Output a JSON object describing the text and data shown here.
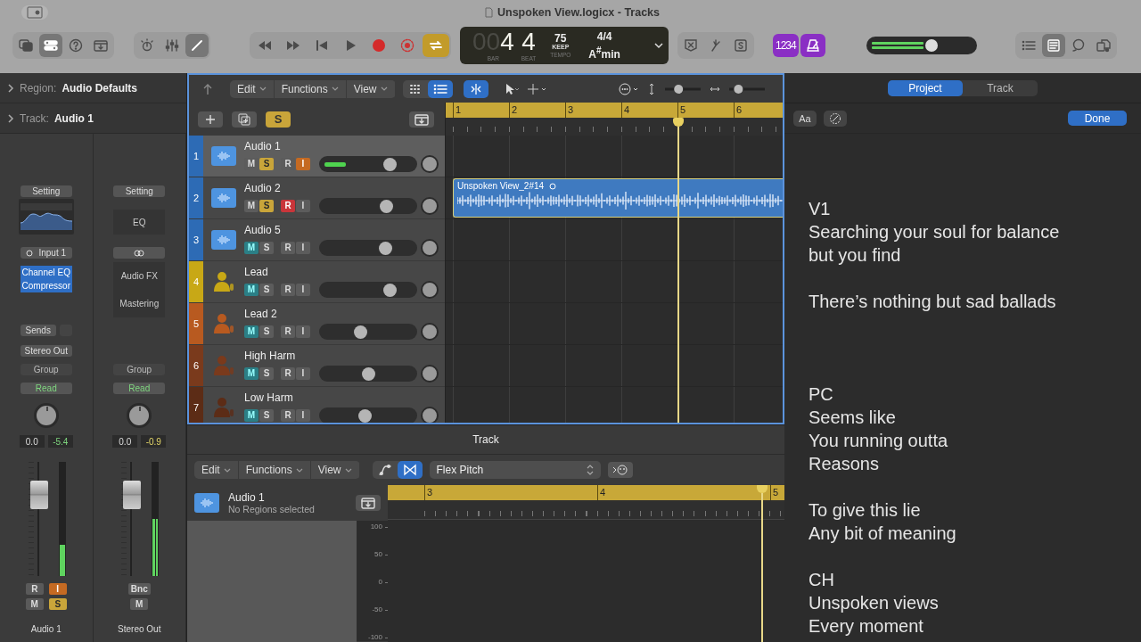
{
  "window": {
    "title": "Unspoken View.logicx - Tracks"
  },
  "toolbar": {
    "view_buttons": [
      {
        "kind": "library",
        "selected": false
      },
      {
        "kind": "inspector",
        "selected": true
      },
      {
        "kind": "help",
        "selected": false
      },
      {
        "kind": "download",
        "selected": false
      }
    ],
    "edit_buttons": [
      {
        "kind": "smart-controls",
        "selected": false
      },
      {
        "kind": "mixer",
        "selected": false
      },
      {
        "kind": "editors",
        "selected": true
      }
    ],
    "transport": [
      {
        "kind": "rewind",
        "selected": false
      },
      {
        "kind": "forward",
        "selected": false
      },
      {
        "kind": "to-start",
        "selected": false
      },
      {
        "kind": "play",
        "selected": false
      },
      {
        "kind": "record",
        "selected": false
      },
      {
        "kind": "capture",
        "selected": false
      },
      {
        "kind": "cycle",
        "selected": true
      }
    ],
    "lcd": {
      "bar_prefix": "00",
      "bar": "4",
      "beat": "4",
      "bar_label": "BAR",
      "beat_label": "BEAT",
      "tempo": "75",
      "tempo_mode": "KEEP",
      "tempo_label": "TEMPO",
      "signature": "4/4",
      "key": "A$^{#}$min"
    },
    "mode_buttons": [
      {
        "kind": "x-box",
        "selected": false
      },
      {
        "kind": "tuner",
        "selected": false
      },
      {
        "kind": "s-box",
        "selected": false
      }
    ],
    "count_in": {
      "label": "1234",
      "selected": true
    },
    "metronome": {
      "selected": true
    },
    "master_volume": {
      "level": 0.6
    },
    "window_buttons": [
      {
        "kind": "list",
        "selected": false
      },
      {
        "kind": "notes",
        "selected": true
      },
      {
        "kind": "loops",
        "selected": false
      },
      {
        "kind": "browser",
        "selected": false
      }
    ]
  },
  "inspector": {
    "region": {
      "label": "Region:",
      "value": "Audio Defaults"
    },
    "track": {
      "label": "Track:",
      "value": "Audio 1"
    },
    "strips": [
      {
        "setting": "Setting",
        "eq": {
          "kind": "graph"
        },
        "input": {
          "kind": "input",
          "text": "Input 1"
        },
        "plugins": [
          "Channel EQ",
          "Compressor"
        ],
        "sends": "Sends",
        "output": "Stereo Out",
        "group": "Group",
        "automation": "Read",
        "volume": "0.0",
        "peak": "-5.4",
        "peak_warning": false,
        "fader": {
          "level": 0.78
        },
        "meter": {
          "level": 0.27
        },
        "buttons_top": [
          {
            "label": "R",
            "kind": "record",
            "on": false
          },
          {
            "label": "I",
            "kind": "input",
            "on": true
          }
        ],
        "buttons_bottom": [
          {
            "label": "M",
            "kind": "mute",
            "on": false
          },
          {
            "label": "S",
            "kind": "solo",
            "on": true
          }
        ],
        "name": "Audio 1"
      },
      {
        "setting": "Setting",
        "eq": {
          "kind": "label",
          "text": "EQ"
        },
        "input": {
          "kind": "link"
        },
        "fx_labels": [
          "Audio FX",
          "Mastering"
        ],
        "group": "Group",
        "automation": "Read",
        "volume": "0.0",
        "peak": "-0.9",
        "peak_warning": true,
        "fader": {
          "level": 0.78
        },
        "meter": {
          "level": 0.5
        },
        "buttons_top": [
          {
            "label": "Bnc",
            "kind": "bounce",
            "on": false
          }
        ],
        "buttons_bottom": [
          {
            "label": "M",
            "kind": "mute",
            "on": false
          }
        ],
        "name": "Stereo Out"
      }
    ]
  },
  "tracks_window": {
    "menus": [
      "Edit",
      "Functions",
      "View"
    ],
    "view_toggles": [
      {
        "kind": "grid",
        "selected": false
      },
      {
        "kind": "list",
        "selected": true
      }
    ],
    "catch": {
      "selected": true
    },
    "vertical_zoom": {
      "level": 0.35
    },
    "horizontal_zoom": {
      "level": 0.2
    },
    "global_solo": {
      "label": "S",
      "selected": true
    },
    "bars": [
      "1",
      "2",
      "3",
      "4",
      "5",
      "6"
    ],
    "tracks": [
      {
        "number": "1",
        "name": "Audio 1",
        "kind": "audio",
        "color": "#2d6bb5",
        "selected": true,
        "buttons": [
          {
            "label": "M",
            "kind": "mute",
            "on": false
          },
          {
            "label": "S",
            "kind": "solo",
            "on": true
          },
          {
            "label": "R",
            "kind": "record",
            "on": false
          },
          {
            "label": "I",
            "kind": "input",
            "on": true
          }
        ],
        "volume": {
          "level": 0.72
        },
        "meter": {
          "level": 0.22
        }
      },
      {
        "number": "2",
        "name": "Audio 2",
        "kind": "audio",
        "color": "#2d6bb5",
        "selected": false,
        "buttons": [
          {
            "label": "M",
            "kind": "mute",
            "on": false
          },
          {
            "label": "S",
            "kind": "solo",
            "on": true
          },
          {
            "label": "R",
            "kind": "record",
            "on": true
          },
          {
            "label": "I",
            "kind": "input",
            "on": false
          }
        ],
        "volume": {
          "level": 0.68
        },
        "region": {
          "name": "Unspoken View_2#14"
        }
      },
      {
        "number": "3",
        "name": "Audio 5",
        "kind": "audio",
        "color": "#2d6bb5",
        "selected": false,
        "buttons": [
          {
            "label": "M",
            "kind": "mute",
            "on": true
          },
          {
            "label": "S",
            "kind": "solo",
            "on": false
          },
          {
            "label": "R",
            "kind": "record",
            "on": false
          },
          {
            "label": "I",
            "kind": "input",
            "on": false
          }
        ],
        "volume": {
          "level": 0.67
        }
      },
      {
        "number": "4",
        "name": "Lead",
        "kind": "person",
        "color": "#c8a816",
        "selected": false,
        "buttons": [
          {
            "label": "M",
            "kind": "mute",
            "on": true
          },
          {
            "label": "S",
            "kind": "solo",
            "on": false
          },
          {
            "label": "R",
            "kind": "record",
            "on": false
          },
          {
            "label": "I",
            "kind": "input",
            "on": false
          }
        ],
        "volume": {
          "level": 0.72
        }
      },
      {
        "number": "5",
        "name": "Lead 2",
        "kind": "person",
        "color": "#b85a20",
        "selected": false,
        "buttons": [
          {
            "label": "M",
            "kind": "mute",
            "on": true
          },
          {
            "label": "S",
            "kind": "solo",
            "on": false
          },
          {
            "label": "R",
            "kind": "record",
            "on": false
          },
          {
            "label": "I",
            "kind": "input",
            "on": false
          }
        ],
        "volume": {
          "level": 0.42
        }
      },
      {
        "number": "6",
        "name": "High Harm",
        "kind": "person",
        "color": "#7a3a1c",
        "selected": false,
        "buttons": [
          {
            "label": "M",
            "kind": "mute",
            "on": true
          },
          {
            "label": "S",
            "kind": "solo",
            "on": false
          },
          {
            "label": "R",
            "kind": "record",
            "on": false
          },
          {
            "label": "I",
            "kind": "input",
            "on": false
          }
        ],
        "volume": {
          "level": 0.5
        }
      },
      {
        "number": "7",
        "name": "Low Harm",
        "kind": "person",
        "color": "#5c2c16",
        "selected": false,
        "buttons": [
          {
            "label": "M",
            "kind": "mute",
            "on": true
          },
          {
            "label": "S",
            "kind": "solo",
            "on": false
          },
          {
            "label": "R",
            "kind": "record",
            "on": false
          },
          {
            "label": "I",
            "kind": "input",
            "on": false
          }
        ],
        "volume": {
          "level": 0.46
        }
      }
    ]
  },
  "editor": {
    "title": "Track",
    "menus": [
      "Edit",
      "Functions",
      "View"
    ],
    "modes": [
      {
        "kind": "curve",
        "selected": false
      },
      {
        "kind": "flex",
        "selected": true
      }
    ],
    "flex_mode": "Flex Pitch",
    "track": {
      "name": "Audio 1",
      "status": "No Regions selected"
    },
    "bars": [
      "3",
      "4",
      "5"
    ],
    "y_labels": [
      "100",
      "50",
      "0",
      "-50",
      "-100"
    ]
  },
  "notes": {
    "tabs": [
      {
        "label": "Project",
        "selected": true
      },
      {
        "label": "Track",
        "selected": false
      }
    ],
    "font_button": "Aa",
    "done": "Done",
    "text": "V1\nSearching your soul for balance\nbut you find\n\nThere’s nothing but sad ballads\n\n\n\nPC\nSeems like\nYou running outta\nReasons\n\nTo give this lie\nAny bit of meaning\n\nCH\nUnspoken views\nEvery moment"
  }
}
